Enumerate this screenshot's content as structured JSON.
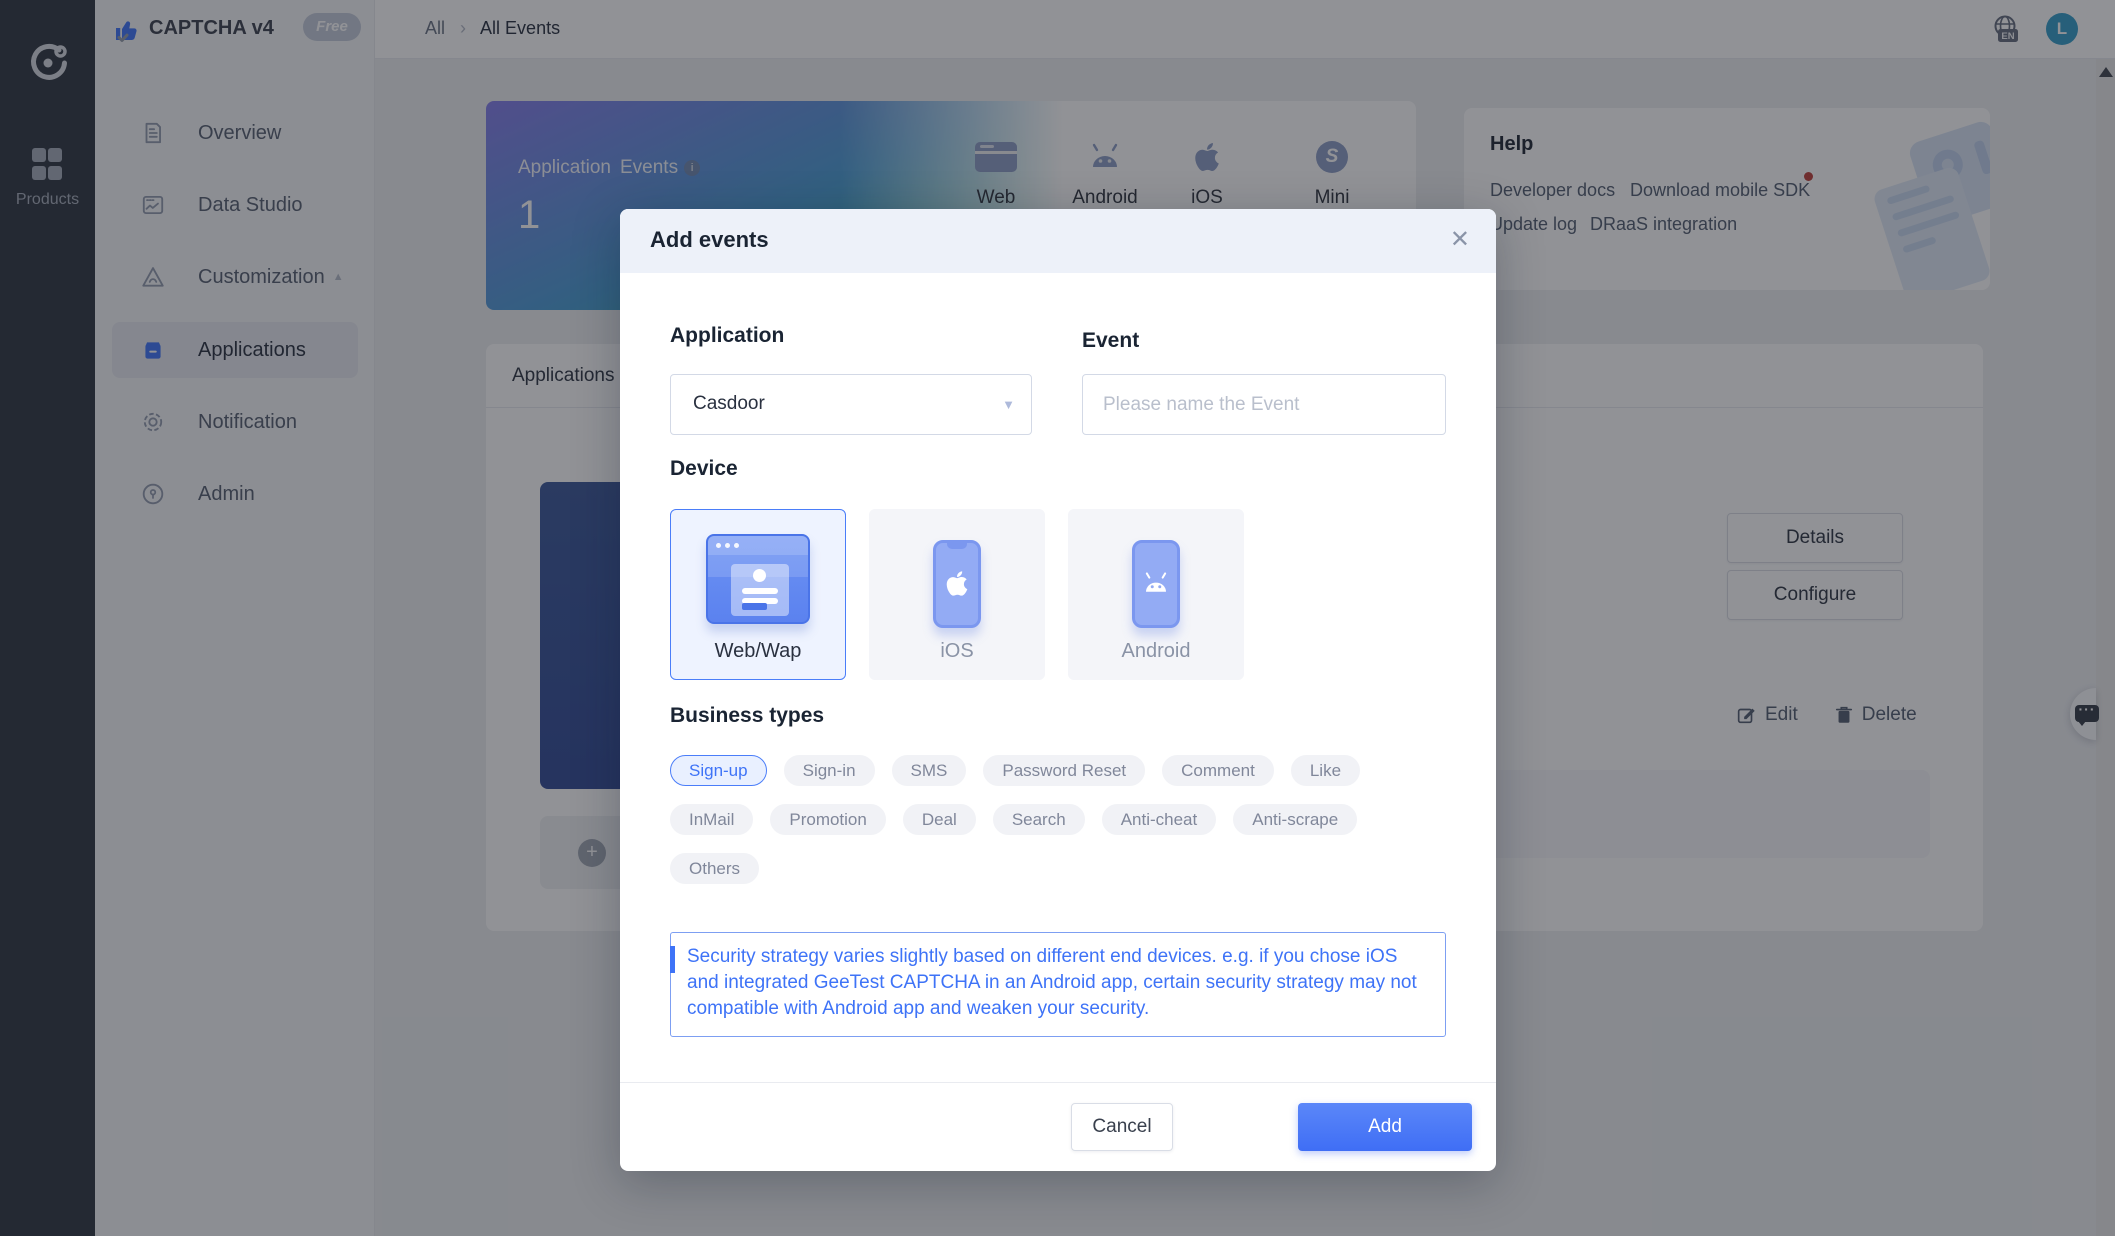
{
  "rail": {
    "products_label": "Products"
  },
  "nav": {
    "title": "CAPTCHA v4",
    "badge": "Free",
    "items": [
      {
        "label": "Overview"
      },
      {
        "label": "Data Studio"
      },
      {
        "label": "Customization"
      },
      {
        "label": "Applications"
      },
      {
        "label": "Notification"
      },
      {
        "label": "Admin"
      }
    ]
  },
  "topbar": {
    "breadcrumb_root": "All",
    "breadcrumb_current": "All Events",
    "lang": "EN",
    "avatar_initial": "L"
  },
  "stats": {
    "application_label": "Application",
    "application_value": "1",
    "events_label": "Events",
    "info_glyph": "i",
    "platforms": [
      {
        "label": "Web"
      },
      {
        "label": "Android"
      },
      {
        "label": "iOS"
      },
      {
        "label": "Mini program"
      }
    ],
    "miniprogram_glyph": "S"
  },
  "help": {
    "title": "Help",
    "links": [
      {
        "label": "Developer docs"
      },
      {
        "label": "Download mobile SDK"
      },
      {
        "label": "Update log"
      },
      {
        "label": "DRaaS integration"
      }
    ]
  },
  "apps_panel": {
    "tab": "Applications",
    "details_label": "Details",
    "configure_label": "Configure",
    "edit_label": "Edit",
    "delete_label": "Delete",
    "add_plus": "+"
  },
  "modal": {
    "title": "Add events",
    "close_glyph": "✕",
    "application_label": "Application",
    "application_value": "Casdoor",
    "select_arrow": "▼",
    "event_label": "Event",
    "event_placeholder": "Please name the Event",
    "device_label": "Device",
    "devices": [
      {
        "label": "Web/Wap"
      },
      {
        "label": "iOS"
      },
      {
        "label": "Android"
      }
    ],
    "business_label": "Business types",
    "business_types": [
      {
        "label": "Sign-up"
      },
      {
        "label": "Sign-in"
      },
      {
        "label": "SMS"
      },
      {
        "label": "Password Reset"
      },
      {
        "label": "Comment"
      },
      {
        "label": "Like"
      },
      {
        "label": "InMail"
      },
      {
        "label": "Promotion"
      },
      {
        "label": "Deal"
      },
      {
        "label": "Search"
      },
      {
        "label": "Anti-cheat"
      },
      {
        "label": "Anti-scrape"
      },
      {
        "label": "Others"
      }
    ],
    "note": "Security strategy varies slightly based on different end devices. e.g. if you chose iOS and integrated GeeTest CAPTCHA in an Android app, certain security strategy may not compatible with Android app and weaken your security.",
    "cancel_label": "Cancel",
    "add_label": "Add"
  },
  "colors": {
    "accent": "#4a7df9",
    "note_text": "#3e73f7",
    "modal_header_bg": "#edf1f9",
    "sidebar_dark": "#3a414c",
    "danger_dot": "#c24a44"
  }
}
